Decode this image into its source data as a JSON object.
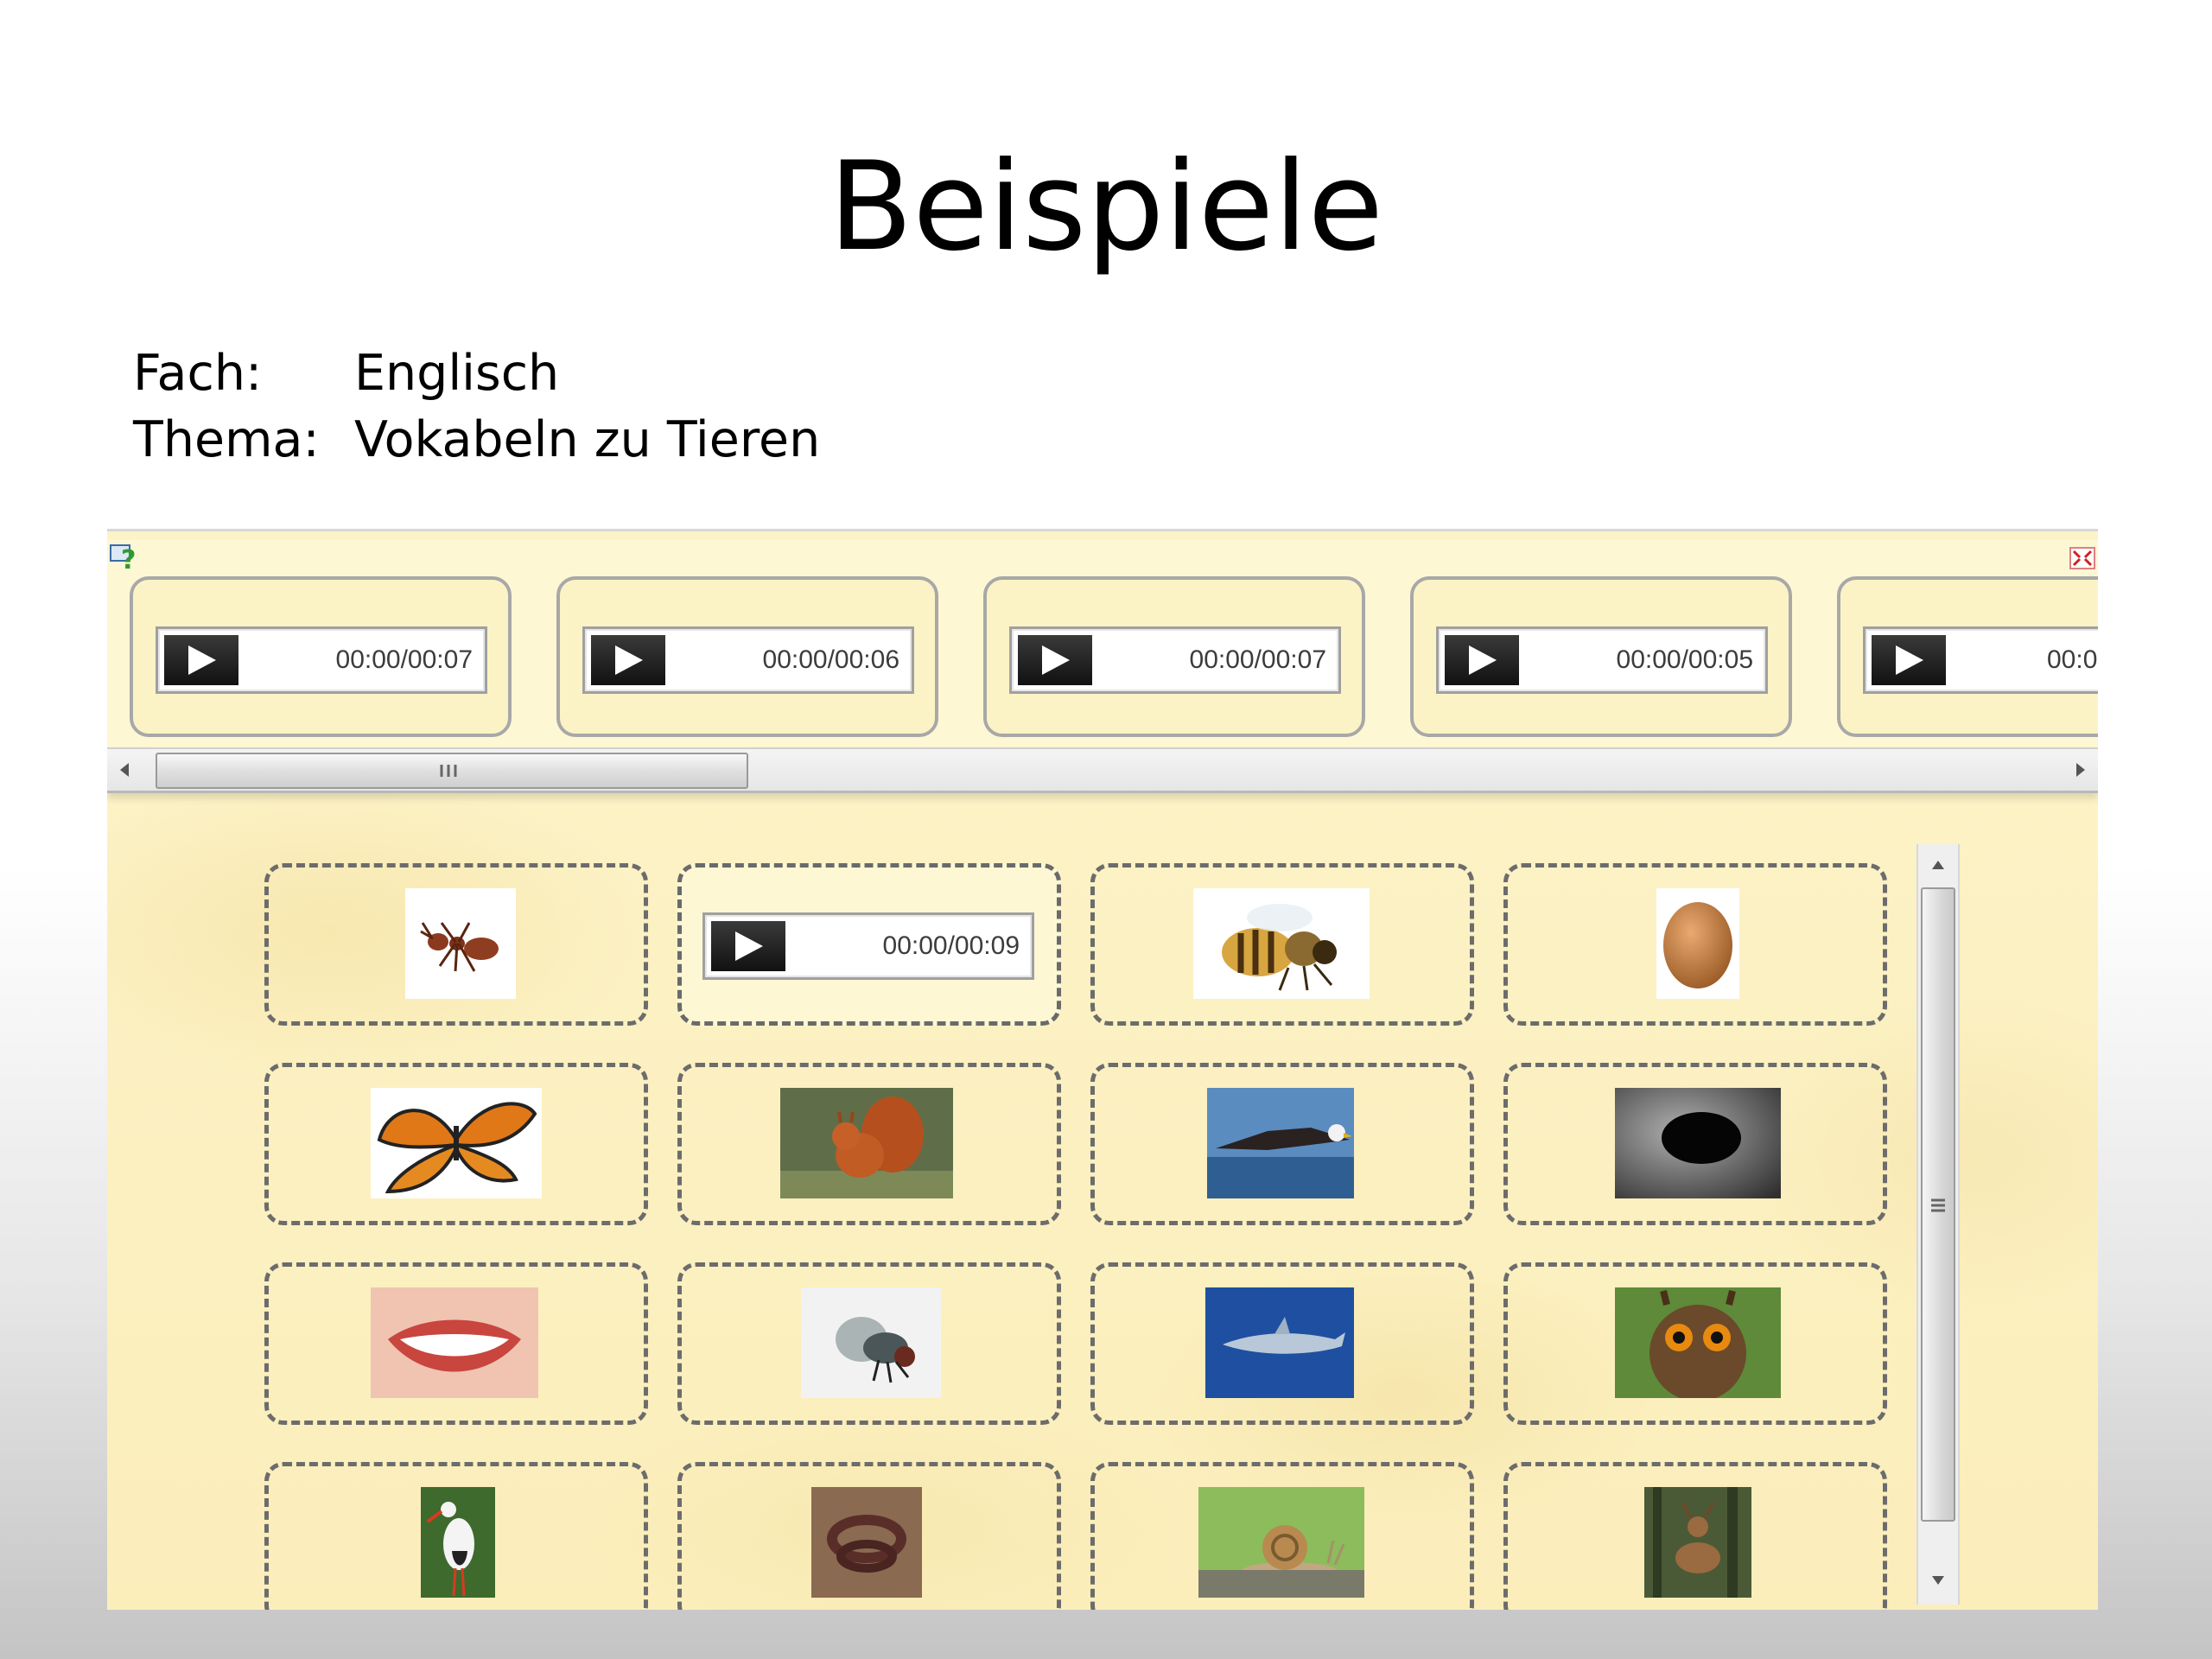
{
  "slide": {
    "title": "Beispiele",
    "fach_label": "Fach:",
    "fach_value": "Englisch",
    "thema_label": "Thema:",
    "thema_value": "Vokabeln zu Tieren"
  },
  "app": {
    "audio_strip": [
      {
        "time": "00:00/00:07"
      },
      {
        "time": "00:00/00:06"
      },
      {
        "time": "00:00/00:07"
      },
      {
        "time": "00:00/00:05"
      },
      {
        "time": "00:0"
      }
    ],
    "grid": {
      "active_player_time": "00:00/00:09",
      "images": [
        "ant-image",
        "audio-player",
        "bee-image",
        "egg-image",
        "butterfly-image",
        "squirrel-image",
        "eagle-image",
        "hole-image",
        "mouth-image",
        "fly-image",
        "shark-image",
        "owl-image",
        "stork-image",
        "snake-image",
        "snail-image",
        "deer-image"
      ]
    },
    "icons": {
      "help": "help-icon",
      "close": "close-icon",
      "play": "play-icon"
    },
    "colors": {
      "panel_background": "#fbf0c2",
      "card_border": "#6c6c6c",
      "player_button": "#1a1a1a"
    }
  }
}
